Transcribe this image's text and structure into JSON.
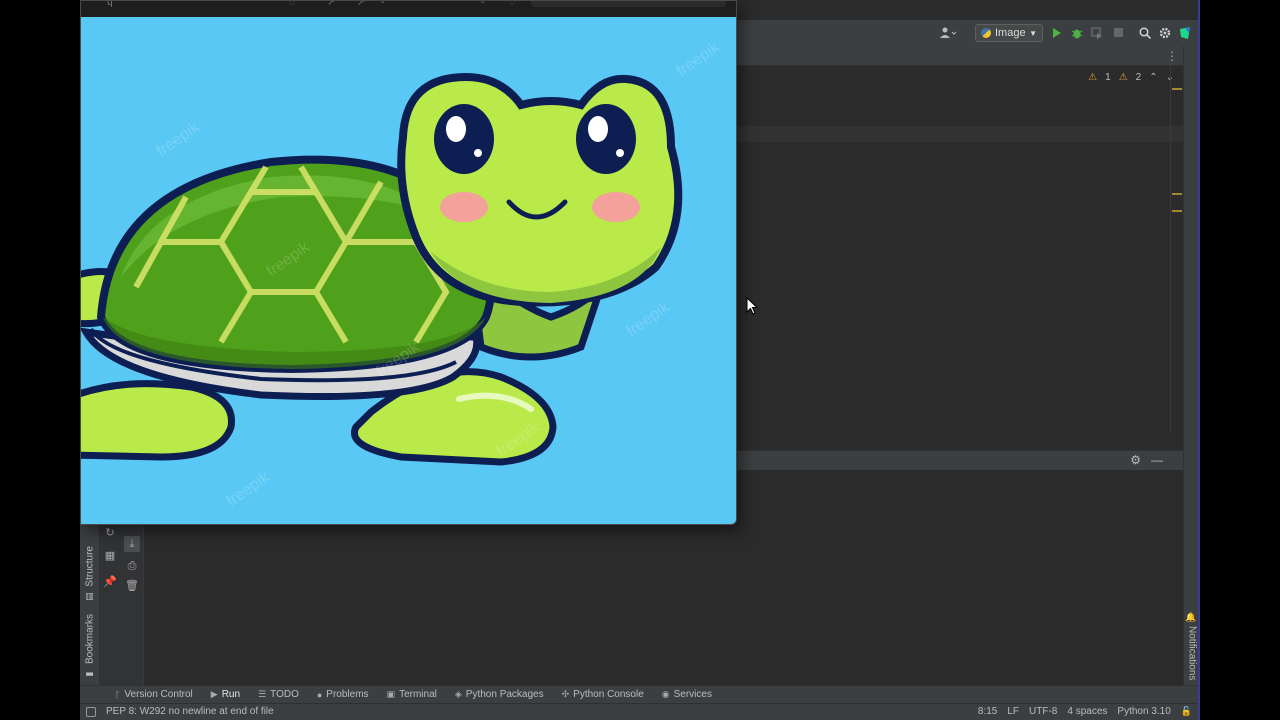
{
  "toolbar": {
    "run_config_label": "Image",
    "colors": {
      "run": "#4eb043",
      "debug": "#4eb043"
    }
  },
  "inspection": {
    "warnings": "1",
    "weak_warnings": "2"
  },
  "left_tabs": {
    "structure": "Structure",
    "bookmarks": "Bookmarks"
  },
  "right_tabs": {
    "notifications": "Notifications"
  },
  "bottom_tabs": [
    {
      "label": "Version Control",
      "icon": "branch-icon"
    },
    {
      "label": "Run",
      "icon": "play-icon"
    },
    {
      "label": "TODO",
      "icon": "list-icon"
    },
    {
      "label": "Problems",
      "icon": "info-icon"
    },
    {
      "label": "Terminal",
      "icon": "terminal-icon"
    },
    {
      "label": "Python Packages",
      "icon": "packages-icon"
    },
    {
      "label": "Python Console",
      "icon": "python-icon"
    },
    {
      "label": "Services",
      "icon": "services-icon"
    }
  ],
  "status": {
    "message": "PEP 8: W292 no newline at end of file",
    "position": "8:15",
    "line_separator": "LF",
    "encoding": "UTF-8",
    "indent": "4 spaces",
    "interpreter": "Python 3.10"
  },
  "viewer_watermark": "freepik"
}
